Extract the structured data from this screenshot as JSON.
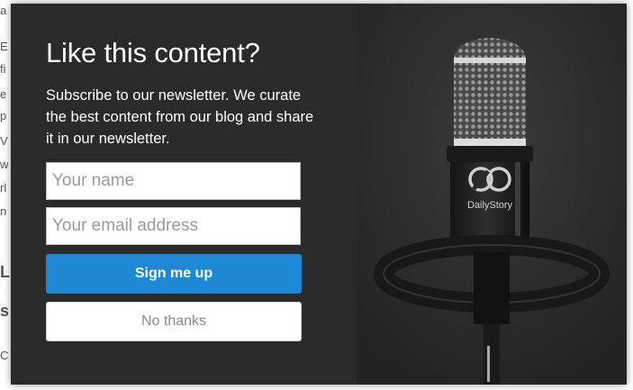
{
  "modal": {
    "title": "Like this content?",
    "subtitle": "Subscribe to our newsletter. We curate the best content from our blog and share it in our newsletter.",
    "name_placeholder": "Your name",
    "email_placeholder": "Your email address",
    "signup_label": "Sign me up",
    "decline_label": "No thanks",
    "brand_name": "DailyStory",
    "accent_color": "#1e88d4"
  }
}
